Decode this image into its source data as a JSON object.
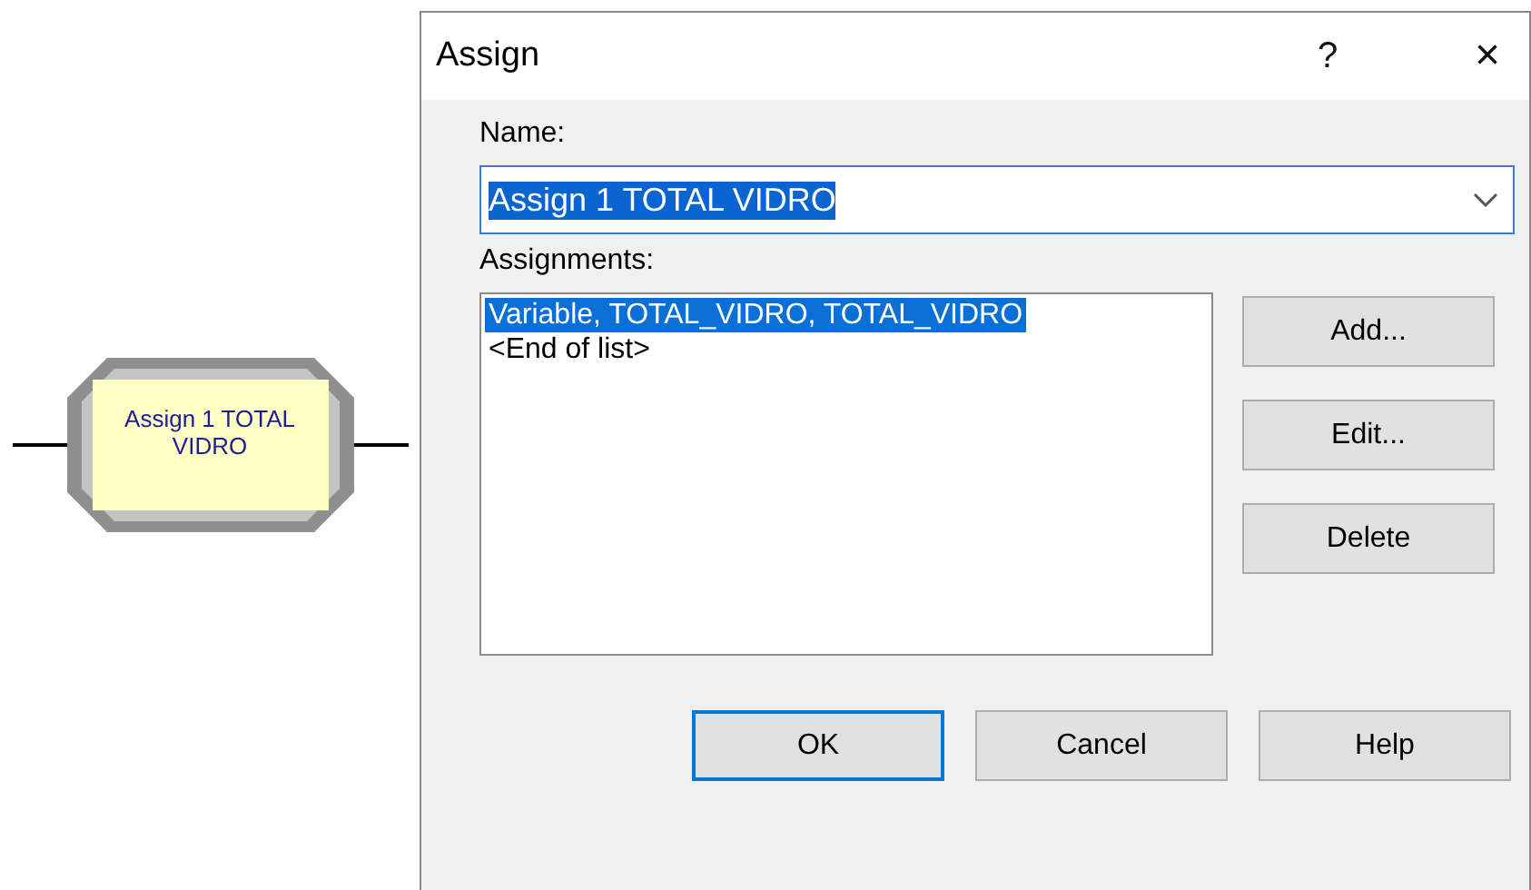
{
  "canvas": {
    "module": {
      "label": "Assign 1 TOTAL VIDRO"
    }
  },
  "window": {
    "title": "Assign",
    "help_glyph": "?",
    "close_glyph": "×"
  },
  "name_field": {
    "label": "Name:",
    "value": "Assign 1 TOTAL VIDRO",
    "text_selected": true
  },
  "assignments": {
    "label": "Assignments:",
    "items": [
      {
        "text": "Variable, TOTAL_VIDRO, TOTAL_VIDRO",
        "selected": true
      },
      {
        "text": "<End of list>",
        "selected": false
      }
    ],
    "buttons": [
      "Add...",
      "Edit...",
      "Delete"
    ]
  },
  "footer_buttons": [
    {
      "label": "OK",
      "default": true
    },
    {
      "label": "Cancel",
      "default": false
    },
    {
      "label": "Help",
      "default": false
    }
  ]
}
